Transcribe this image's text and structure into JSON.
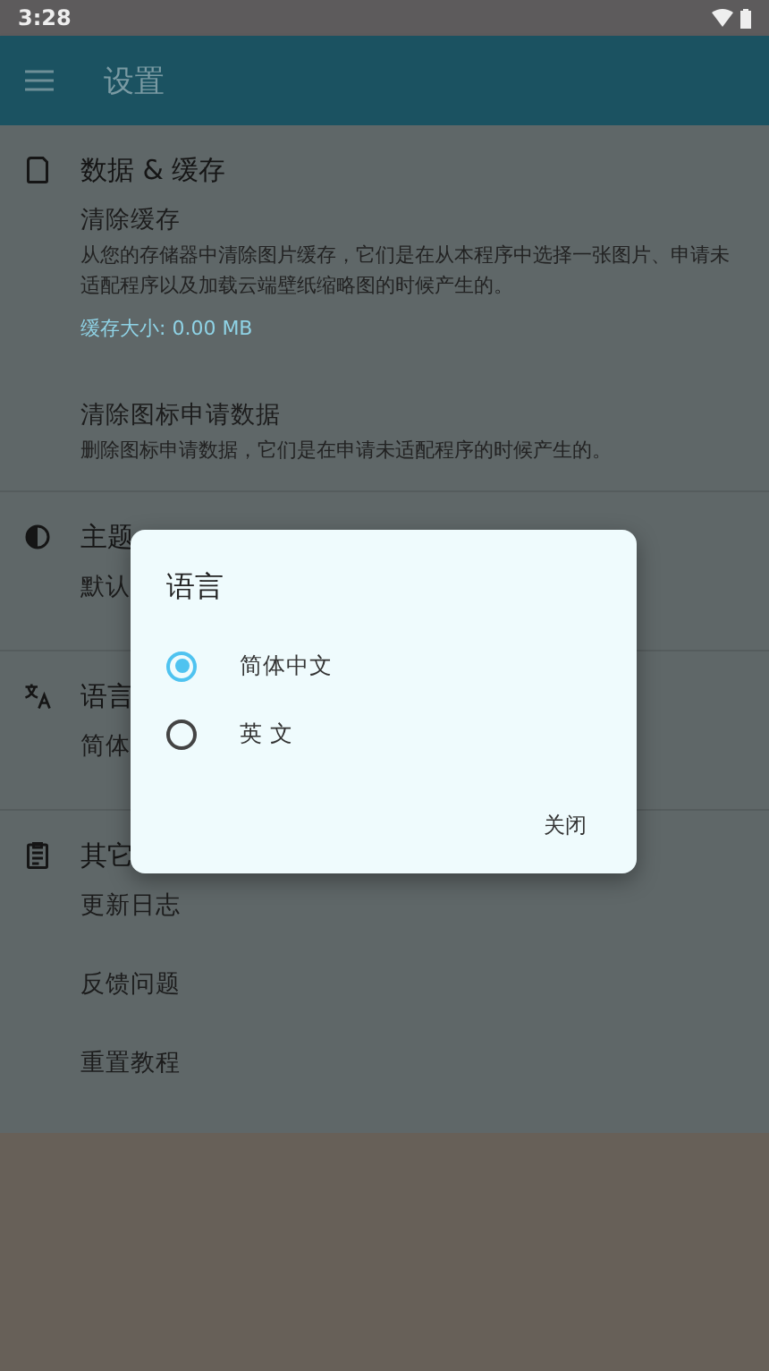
{
  "status_bar": {
    "time": "3:28"
  },
  "app_bar": {
    "title": "设置"
  },
  "sections": [
    {
      "kind": "storage",
      "title": "数据 & 缓存",
      "items": [
        {
          "title": "清除缓存",
          "description": "从您的存储器中清除图片缓存，它们是在从本程序中选择一张图片、申请未适配程序以及加载云端壁纸缩略图的时候产生的。",
          "note": "缓存大小: 0.00 MB"
        },
        {
          "title": "清除图标申请数据",
          "description": "删除图标申请数据，它们是在申请未适配程序的时候产生的。"
        }
      ]
    },
    {
      "kind": "theme",
      "title": "主题",
      "items": [
        {
          "title": "默认"
        }
      ]
    },
    {
      "kind": "language",
      "title": "语言",
      "items": [
        {
          "title": "简体"
        }
      ]
    },
    {
      "kind": "other",
      "title": "其它",
      "items": [
        {
          "title": "更新日志"
        },
        {
          "title": "反馈问题"
        },
        {
          "title": "重置教程"
        }
      ]
    }
  ],
  "dialog": {
    "title": "语言",
    "options": [
      {
        "label": "简体中文",
        "selected": true
      },
      {
        "label": "英 文",
        "selected": false
      }
    ],
    "button": "关闭"
  }
}
